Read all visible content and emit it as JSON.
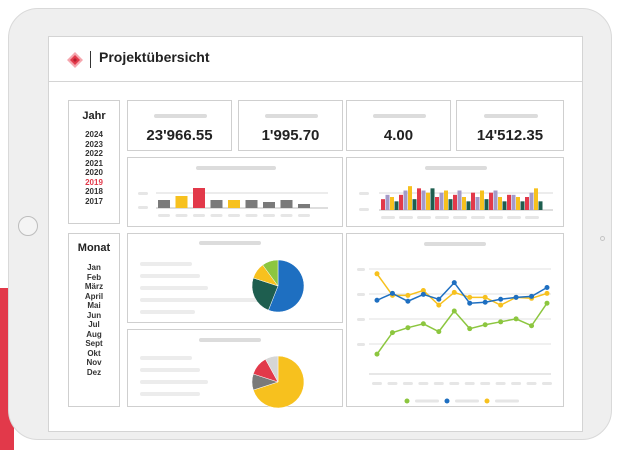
{
  "header": {
    "title": "Projektübersicht"
  },
  "year_filter": {
    "title": "Jahr",
    "items": [
      "2024",
      "2023",
      "2022",
      "2021",
      "2020",
      "2019",
      "2018",
      "2017"
    ],
    "selected": "2019"
  },
  "month_filter": {
    "title": "Monat",
    "items": [
      "Jan",
      "Feb",
      "März",
      "April",
      "Mai",
      "Jun",
      "Jul",
      "Aug",
      "Sept",
      "Okt",
      "Nov",
      "Dez"
    ]
  },
  "kpis": [
    "23'966.55",
    "1'995.70",
    "4.00",
    "14'512.35"
  ],
  "colors": {
    "accent_red": "#e2394a",
    "gray": "#7a7a7a",
    "yellow": "#f7c11e",
    "lavender": "#a49ac8",
    "dark_green": "#1e5e4f",
    "blue": "#1e6fc1",
    "green": "#8cc63f"
  },
  "chart_data": [
    {
      "type": "bar",
      "series": [
        {
          "values": [
            2,
            3,
            5,
            2,
            2,
            2,
            1.5,
            2,
            1
          ]
        }
      ],
      "colors": [
        "#7a7a7a",
        "#f7c11e",
        "#e2394a",
        "#7a7a7a",
        "#f7c11e",
        "#7a7a7a",
        "#7a7a7a",
        "#7a7a7a",
        "#7a7a7a"
      ],
      "ylim": [
        0,
        5
      ],
      "grid": true
    },
    {
      "type": "bar",
      "series": [
        {
          "values": [
            2.5,
            3.5,
            5,
            3,
            3.5,
            4,
            4,
            3.5,
            3
          ]
        },
        {
          "values": [
            3.5,
            4.5,
            4.5,
            4,
            4.5,
            3,
            4.5,
            3.5,
            4
          ]
        },
        {
          "values": [
            3,
            5.5,
            4,
            4.5,
            3,
            4.5,
            3,
            3,
            5
          ]
        },
        {
          "values": [
            2,
            2.5,
            5,
            2.5,
            2,
            2.5,
            2,
            2,
            2
          ]
        }
      ],
      "colors": [
        "#e2394a",
        "#a49ac8",
        "#f7c11e",
        "#1e5e4f"
      ],
      "ylim": [
        0,
        6
      ],
      "grid": true
    },
    {
      "type": "pie",
      "values": [
        56,
        24,
        10,
        10
      ],
      "colors": [
        "#1e6fc1",
        "#1e5e4f",
        "#f7c11e",
        "#8cc63f"
      ]
    },
    {
      "type": "pie",
      "values": [
        70,
        10,
        12,
        8
      ],
      "colors": [
        "#f7c11e",
        "#7a7a7a",
        "#e2394a",
        "#d6d6d6"
      ]
    },
    {
      "type": "line",
      "series": [
        {
          "color": "#f7c11e",
          "values": [
            9,
            6.8,
            6.8,
            7.3,
            5.8,
            7.1,
            6.6,
            6.6,
            5.8,
            6.6,
            6.5,
            7
          ]
        },
        {
          "color": "#1e6fc1",
          "values": [
            6.3,
            7,
            6.2,
            6.9,
            6.4,
            8.1,
            6,
            6.1,
            6.4,
            6.6,
            6.7,
            7.6
          ]
        },
        {
          "color": "#8cc63f",
          "values": [
            0.8,
            3,
            3.5,
            3.9,
            3.1,
            5.2,
            3.4,
            3.8,
            4.1,
            4.4,
            3.7,
            6
          ]
        }
      ],
      "ylim": [
        0,
        10
      ],
      "grid": true
    }
  ]
}
